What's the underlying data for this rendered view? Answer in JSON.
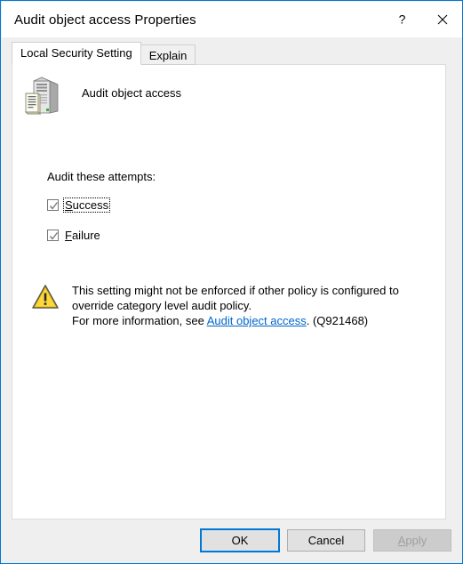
{
  "window": {
    "title": "Audit object access Properties",
    "help_button": "?",
    "close_button": "✕",
    "accent_color": "#0078d7"
  },
  "tabs": [
    {
      "label": "Local Security Setting",
      "selected": true
    },
    {
      "label": "Explain",
      "selected": false
    }
  ],
  "panel": {
    "icon_name": "server-policy-icon",
    "policy_name": "Audit object access",
    "audit_attempts_label": "Audit these attempts:",
    "checkboxes": [
      {
        "label_prefix": "",
        "accel": "S",
        "label_suffix": "uccess",
        "full_label": "Success",
        "checked": true,
        "focused": true
      },
      {
        "label_prefix": "",
        "accel": "F",
        "label_suffix": "ailure",
        "full_label": "Failure",
        "checked": true,
        "focused": false
      }
    ],
    "warning": {
      "icon_name": "warning-triangle-icon",
      "line1": "This setting might not be enforced if other policy is configured to",
      "line2": "override category level audit policy.",
      "line3_prefix": "For more information, see ",
      "link_text": "Audit object access",
      "line3_suffix": ". (Q921468)",
      "link_color": "#0066cc"
    }
  },
  "buttons": {
    "ok": "OK",
    "cancel": "Cancel",
    "apply_prefix": "",
    "apply_accel": "A",
    "apply_suffix": "pply",
    "apply_full": "Apply",
    "apply_disabled": true
  }
}
